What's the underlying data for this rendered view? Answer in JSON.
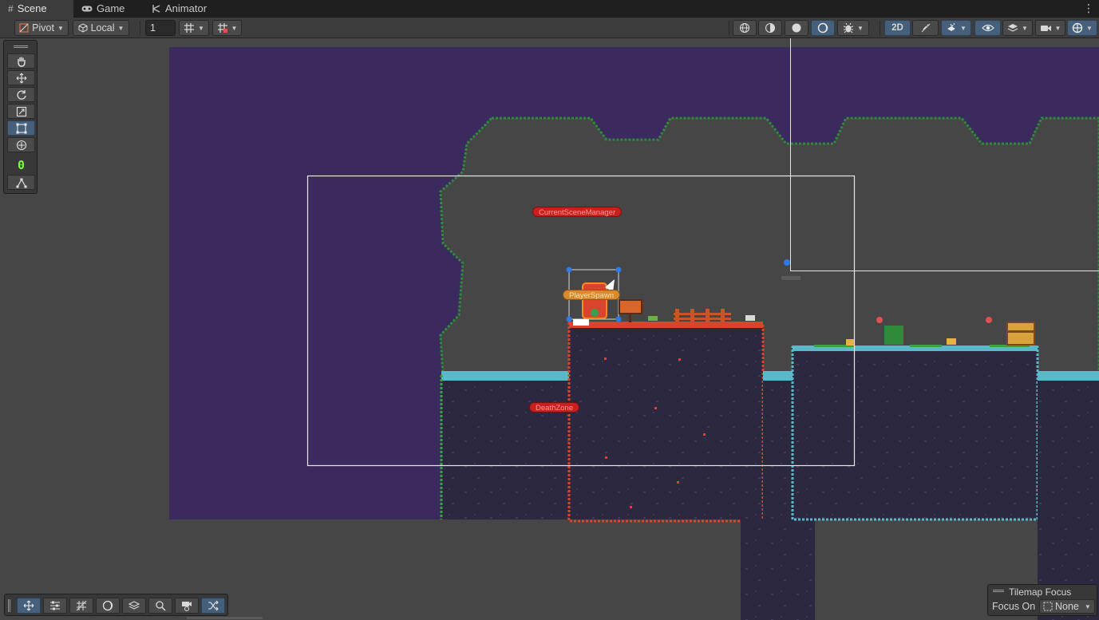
{
  "tabs": [
    {
      "label": "Scene",
      "icon": "grid-icon",
      "active": true
    },
    {
      "label": "Game",
      "icon": "gamepad-icon",
      "active": false
    },
    {
      "label": "Animator",
      "icon": "animator-icon",
      "active": false
    }
  ],
  "toolbar": {
    "pivot_label": "Pivot",
    "local_label": "Local",
    "grid_size_value": "1",
    "mode_2d_label": "2D"
  },
  "palette": {
    "tools": [
      "hand-tool",
      "move-tool",
      "rotate-tool",
      "scale-tool",
      "rect-tool",
      "transform-tool",
      "custom-tool"
    ],
    "active_tool": "rect-tool",
    "counter_value": "0"
  },
  "scene": {
    "labels": {
      "scene_manager": "CurrentSceneManager",
      "player_spawn": "PlayerSpawn",
      "death_zone": "DeathZone"
    },
    "colors": {
      "background": "#3b2a5e",
      "cave": "#464646",
      "red_platform": "#d9452c",
      "blue_platform": "#5bb8c8",
      "grass": "#3aa04a",
      "dirt": "#2c2840"
    }
  },
  "tilemap_focus": {
    "title": "Tilemap Focus",
    "focus_on_label": "Focus On",
    "focus_on_value": "None"
  }
}
